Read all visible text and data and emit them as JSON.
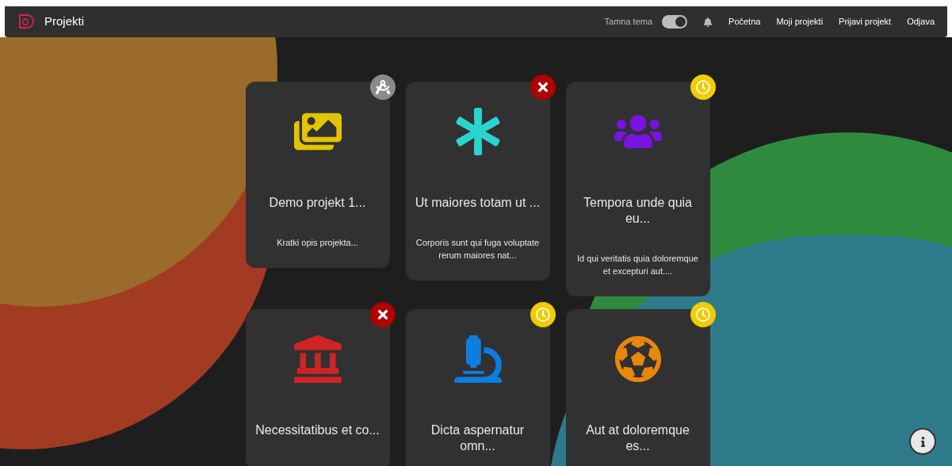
{
  "navbar": {
    "title": "Projekti",
    "theme_toggle": {
      "label": "Tamna tema",
      "on": true
    },
    "links": [
      "Početna",
      "Moji projekti",
      "Prijavi projekt",
      "Odjava"
    ]
  },
  "projects": [
    {
      "kind": "images",
      "color": "#e3c400",
      "badge": {
        "kind": "review"
      },
      "title": "Demo projekt 1...",
      "description": "Kratki opis projekta..."
    },
    {
      "kind": "asterisk",
      "color": "#2ad4d0",
      "badge": {
        "kind": "rejected"
      },
      "title": "Ut maiores totam ut ...",
      "description": "Corporis sunt qui fuga voluptate rerum maiores nat..."
    },
    {
      "kind": "users",
      "color": "#7a12e0",
      "badge": {
        "kind": "pending"
      },
      "title": "Tempora unde quia eu...",
      "description": "Id qui veritatis quia doloremque et excepturi aut...."
    },
    {
      "kind": "landmark",
      "color": "#d02424",
      "badge": {
        "kind": "rejected"
      },
      "title": "Necessitatibus et co..."
    },
    {
      "kind": "microscope",
      "color": "#0d7de0",
      "badge": {
        "kind": "pending"
      },
      "title": "Dicta aspernatur omn..."
    },
    {
      "kind": "football",
      "color": "#e8870c",
      "badge": {
        "kind": "pending"
      },
      "title": "Aut at doloremque es..."
    }
  ]
}
